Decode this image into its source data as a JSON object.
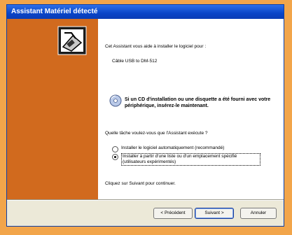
{
  "window": {
    "title": "Assistant Matériel détecté"
  },
  "wizard": {
    "intro": "Cet Assistant vous aide à installer le logiciel pour :",
    "device": "Câble USB to DM-512",
    "cd_prompt": "Si un CD d'installation ou une disquette a été fourni avec votre périphérique, insérez-le maintenant.",
    "question": "Quelle tâche voulez-vous que l'Assistant exécute ?",
    "options": [
      {
        "label": "Installer le logiciel automatiquement (recommandé)",
        "selected": false
      },
      {
        "label": "Installer à partir d'une liste ou d'un emplacement spécifié (utilisateurs expérimentés)",
        "selected": true
      }
    ],
    "continue_text": "Cliquez sur Suivant pour continuer."
  },
  "buttons": {
    "back": "< Précédent",
    "next": "Suivant >",
    "cancel": "Annuler"
  },
  "colors": {
    "titlebar": "#0a45c8",
    "sidepanel": "#d16a1e",
    "background": "#f2a54a"
  }
}
